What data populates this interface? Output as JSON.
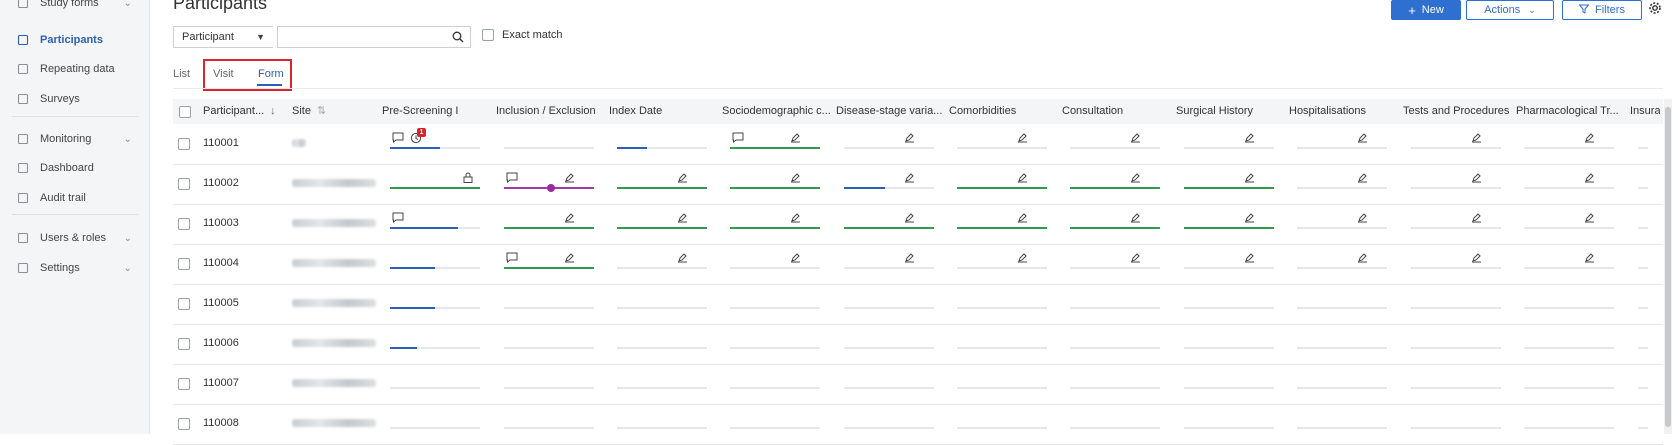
{
  "sidebar": {
    "items": [
      {
        "label": "Study forms",
        "icon": "form-icon",
        "chevron": true,
        "active": false
      },
      {
        "label": "Participants",
        "icon": "folder-icon",
        "chevron": false,
        "active": true
      },
      {
        "label": "Repeating data",
        "icon": "document-icon",
        "chevron": false,
        "active": false
      },
      {
        "label": "Surveys",
        "icon": "document-icon",
        "chevron": false,
        "active": false
      },
      {
        "label": "Monitoring",
        "icon": "monitoring-icon",
        "chevron": true,
        "active": false
      },
      {
        "label": "Dashboard",
        "icon": "chart-icon",
        "chevron": false,
        "active": false
      },
      {
        "label": "Audit trail",
        "icon": "audit-icon",
        "chevron": false,
        "active": false
      },
      {
        "label": "Users & roles",
        "icon": "user-icon",
        "chevron": true,
        "active": false
      },
      {
        "label": "Settings",
        "icon": "gear-icon",
        "chevron": true,
        "active": false
      }
    ]
  },
  "header": {
    "title": "Participants",
    "new_label": "New",
    "actions_label": "Actions",
    "filters_label": "Filters"
  },
  "search": {
    "field_select": "Participant",
    "value": "",
    "exact_match_label": "Exact match"
  },
  "tabs": [
    {
      "label": "List",
      "active": false
    },
    {
      "label": "Visit",
      "active": false
    },
    {
      "label": "Form",
      "active": true
    }
  ],
  "table": {
    "columns": [
      "Participant...",
      "Site",
      "Pre-Screening I",
      "Inclusion / Exclusion",
      "Index Date",
      "Sociodemographic c...",
      "Disease-stage varia...",
      "Comorbidities",
      "Consultation",
      "Surgical History",
      "Hospitalisations",
      "Tests and Procedures",
      "Pharmacological Tr...",
      "Insuran"
    ],
    "rows": [
      {
        "id": "110001",
        "cells": [
          {
            "fill": 0.55,
            "color": "blue",
            "comment": true,
            "query": true,
            "badge": "1"
          },
          {
            "fill": 0,
            "color": ""
          },
          {
            "fill": 0.33,
            "color": "blue"
          },
          {
            "fill": 1,
            "color": "green",
            "comment": true,
            "edit": true
          },
          {
            "fill": 0,
            "color": "",
            "edit": true
          },
          {
            "fill": 0,
            "color": "",
            "edit": true
          },
          {
            "fill": 0,
            "color": "",
            "edit": true
          },
          {
            "fill": 0,
            "color": "",
            "edit": true
          },
          {
            "fill": 0,
            "color": "",
            "edit": true
          },
          {
            "fill": 0,
            "color": "",
            "edit": true
          },
          {
            "fill": 0,
            "color": "",
            "edit": true
          }
        ]
      },
      {
        "id": "110002",
        "cells": [
          {
            "fill": 1,
            "color": "green",
            "lock": true
          },
          {
            "fill": 1,
            "color": "purple",
            "comment": true,
            "edit": true,
            "blocked": true
          },
          {
            "fill": 1,
            "color": "green",
            "edit": true
          },
          {
            "fill": 1,
            "color": "green",
            "edit": true
          },
          {
            "fill": 0.45,
            "color": "blue",
            "edit": true
          },
          {
            "fill": 1,
            "color": "green",
            "edit": true
          },
          {
            "fill": 1,
            "color": "green",
            "edit": true
          },
          {
            "fill": 1,
            "color": "green",
            "edit": true
          },
          {
            "fill": 0,
            "color": "",
            "edit": true
          },
          {
            "fill": 0,
            "color": "",
            "edit": true
          },
          {
            "fill": 0,
            "color": "",
            "edit": true
          }
        ]
      },
      {
        "id": "110003",
        "cells": [
          {
            "fill": 0.75,
            "color": "blue",
            "comment": true
          },
          {
            "fill": 1,
            "color": "green",
            "edit": true
          },
          {
            "fill": 1,
            "color": "green",
            "edit": true
          },
          {
            "fill": 1,
            "color": "green",
            "edit": true
          },
          {
            "fill": 1,
            "color": "green",
            "edit": true
          },
          {
            "fill": 1,
            "color": "green",
            "edit": true
          },
          {
            "fill": 1,
            "color": "green",
            "edit": true
          },
          {
            "fill": 1,
            "color": "green",
            "edit": true
          },
          {
            "fill": 0,
            "color": "",
            "edit": true
          },
          {
            "fill": 0,
            "color": "",
            "edit": true
          },
          {
            "fill": 0,
            "color": "",
            "edit": true
          }
        ]
      },
      {
        "id": "110004",
        "cells": [
          {
            "fill": 0.5,
            "color": "blue"
          },
          {
            "fill": 1,
            "color": "green",
            "comment": true,
            "edit": true
          },
          {
            "fill": 0,
            "color": "",
            "edit": true
          },
          {
            "fill": 0,
            "color": "",
            "edit": true
          },
          {
            "fill": 0,
            "color": "",
            "edit": true
          },
          {
            "fill": 0,
            "color": "",
            "edit": true
          },
          {
            "fill": 0,
            "color": "",
            "edit": true
          },
          {
            "fill": 0,
            "color": "",
            "edit": true
          },
          {
            "fill": 0,
            "color": "",
            "edit": true
          },
          {
            "fill": 0,
            "color": "",
            "edit": true
          },
          {
            "fill": 0,
            "color": "",
            "edit": true
          }
        ]
      },
      {
        "id": "110005",
        "cells": [
          {
            "fill": 0.5,
            "color": "blue"
          }
        ]
      },
      {
        "id": "110006",
        "cells": [
          {
            "fill": 0.3,
            "color": "blue"
          }
        ]
      },
      {
        "id": "110007",
        "cells": [
          {
            "fill": 0,
            "color": ""
          }
        ]
      },
      {
        "id": "110008",
        "cells": [
          {
            "fill": 0,
            "color": ""
          }
        ]
      }
    ]
  },
  "colors": {
    "accent": "#2f6fd0",
    "blue": "#2f5fb3",
    "green": "#2e9b4f",
    "purple": "#a23aa8",
    "empty": "#e5e7ea",
    "highlight": "#d9232d"
  },
  "icons": {
    "comment": "comment-icon",
    "query": "query-icon",
    "edit": "pen-icon",
    "lock": "lock-icon",
    "blocked": "blocked-icon"
  }
}
